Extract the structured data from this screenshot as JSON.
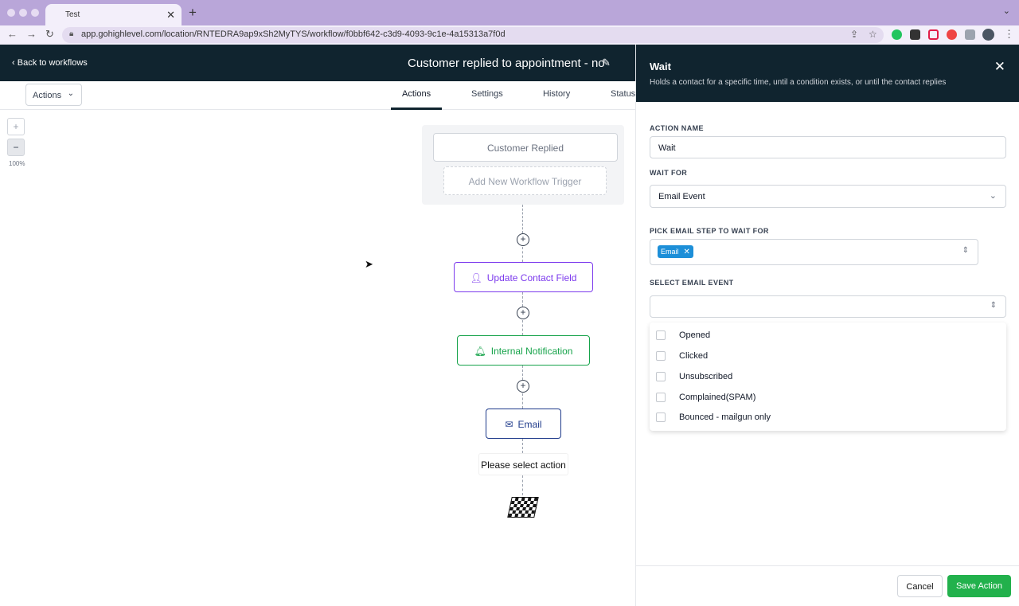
{
  "browser": {
    "tab_title": "Test",
    "url": "app.gohighlevel.com/location/RNTEDRA9ap9xSh2MyTYS/workflow/f0bbf642-c3d9-4093-9c1e-4a15313a7f0d"
  },
  "header": {
    "back_label": "Back to workflows",
    "workflow_title": "Customer replied to appointment - no"
  },
  "toolbar": {
    "actions_dropdown": "Actions",
    "tabs": [
      {
        "label": "Actions",
        "active": true
      },
      {
        "label": "Settings",
        "active": false
      },
      {
        "label": "History",
        "active": false
      },
      {
        "label": "Status",
        "active": false
      }
    ]
  },
  "canvas": {
    "zoom_in": "+",
    "zoom_out": "−",
    "zoom_level": "100%",
    "trigger_label": "Customer Replied",
    "add_trigger_label": "Add New Workflow Trigger",
    "nodes": [
      {
        "label": "Update Contact Field",
        "icon": "user-edit-icon",
        "color": "#7c3aed"
      },
      {
        "label": "Internal Notification",
        "icon": "bell-icon",
        "color": "#16a34a"
      },
      {
        "label": "Email",
        "icon": "envelope-icon",
        "color": "#1e3a8a"
      }
    ],
    "select_action_label": "Please select action",
    "end_icon": "finish-flag-icon"
  },
  "panel": {
    "title": "Wait",
    "description": "Holds a contact for a specific time, until a condition exists, or until the contact replies",
    "action_name_label": "ACTION NAME",
    "action_name_value": "Wait",
    "wait_for_label": "WAIT FOR",
    "wait_for_value": "Email Event",
    "pick_email_label": "PICK EMAIL STEP TO WAIT FOR",
    "pick_email_chip": "Email",
    "select_event_label": "SELECT EMAIL EVENT",
    "select_event_value": "",
    "event_options": [
      "Opened",
      "Clicked",
      "Unsubscribed",
      "Complained(SPAM)",
      "Bounced - mailgun only"
    ],
    "cancel_label": "Cancel",
    "save_label": "Save Action"
  },
  "colors": {
    "header_bg": "#10242f",
    "accent_green": "#22b14c",
    "chip_blue": "#1d8fd8"
  }
}
